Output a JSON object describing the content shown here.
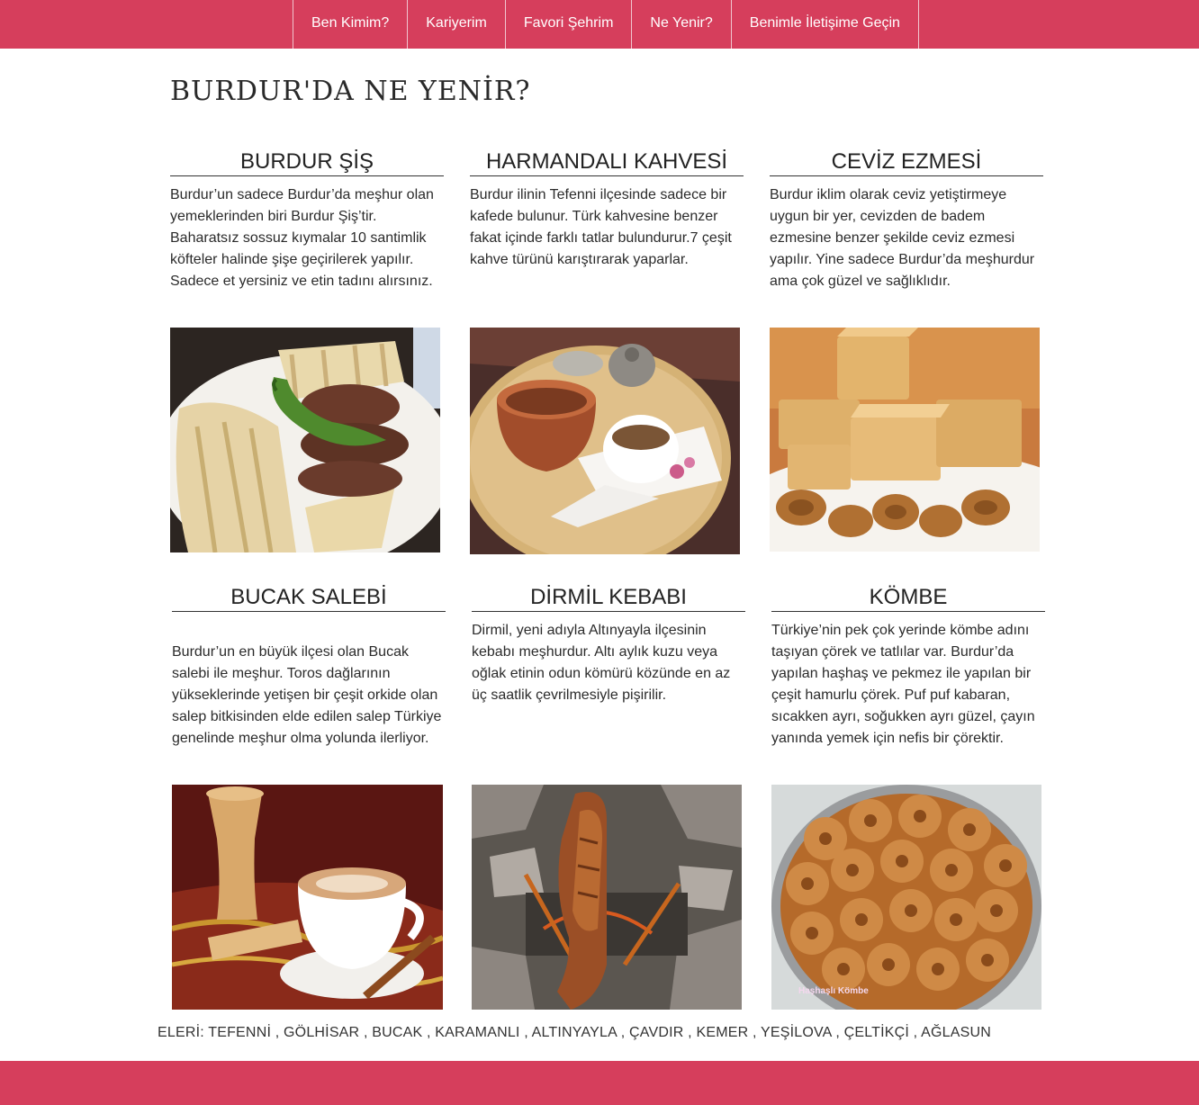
{
  "nav": {
    "items": [
      "Ben Kimim?",
      "Kariyerim",
      "Favori Şehrim",
      "Ne Yenir?",
      "Benimle İletişime Geçin"
    ]
  },
  "page": {
    "title": "BURDUR'DA NE YENİR?"
  },
  "foods": [
    {
      "title": "BURDUR ŞİŞ",
      "text": "Burdur’un sadece Burdur’da meşhur olan yemeklerinden biri Burdur Şiş’tir. Baharatsız sossuz kıymalar 10 santimlik köfteler halinde şişe geçirilerek yapılır. Sadece et yersiniz ve etin tadını alırsınız."
    },
    {
      "title": "HARMANDALI KAHVESİ",
      "text": "Burdur ilinin Tefenni ilçesinde sadece bir kafede bulunur. Türk kahvesine benzer fakat içinde farklı tatlar bulundurur.7 çeşit kahve türünü karıştırarak yaparlar."
    },
    {
      "title": "CEVİZ EZMESİ",
      "text": "Burdur iklim olarak ceviz yetiştirmeye uygun bir yer, cevizden de badem ezmesine benzer şekilde ceviz ezmesi yapılır. Yine sadece Burdur’da meşhurdur ama çok güzel ve sağlıklıdır."
    },
    {
      "title": "BUCAK SALEBİ",
      "text": "Burdur’un en büyük ilçesi olan Bucak salebi ile meşhur. Toros dağlarının yükseklerinde yetişen bir çeşit orkide olan salep bitkisinden elde edilen salep Türkiye genelinde meşhur olma yolunda ilerliyor."
    },
    {
      "title": "DİRMİL KEBABI",
      "text": "Dirmil, yeni adıyla Altınyayla ilçesinin kebabı meşhurdur. Altı aylık kuzu veya oğlak etinin odun kömürü közünde en az üç saatlik çevrilmesiyle pişirilir."
    },
    {
      "title": "KÖMBE",
      "text": "Türkiye’nin pek çok yerinde kömbe adını taşıyan çörek ve tatlılar var. Burdur’da yapılan haşhaş ve pekmez ile yapılan bir çeşit hamurlu çörek. Puf puf kabaran, sıcakken ayrı, soğukken ayrı güzel, çayın yanında yemek için nefis bir çörektir."
    }
  ],
  "images": {
    "kombe_caption": "Haşhaşlı Kömbe"
  },
  "districts_text": "ELERİ: TEFENNİ , GÖLHİSAR , BUCAK , KARAMANLI , ALTINYAYLA , ÇAVDIR , KEMER , YEŞİLOVA , ÇELTİKÇİ , AĞLASUN",
  "colors": {
    "accent": "#d63e5c",
    "text": "#222222",
    "background": "#ffffff"
  }
}
